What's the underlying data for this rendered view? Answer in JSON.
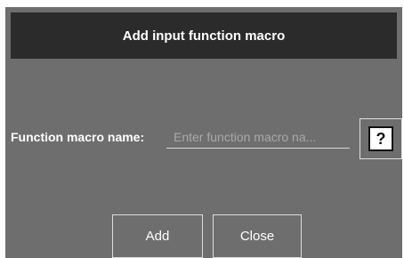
{
  "dialog": {
    "title": "Add input function macro",
    "field": {
      "label": "Function macro name:",
      "value": "",
      "placeholder": "Enter function macro na..."
    },
    "help_icon_glyph": "?",
    "buttons": {
      "add_label": "Add",
      "close_label": "Close"
    }
  },
  "colors": {
    "dialog_bg": "#6e6e6e",
    "titlebar_bg": "#2b2b2b",
    "text": "#ffffff"
  },
  "icons": {
    "help": "question-mark-icon"
  }
}
